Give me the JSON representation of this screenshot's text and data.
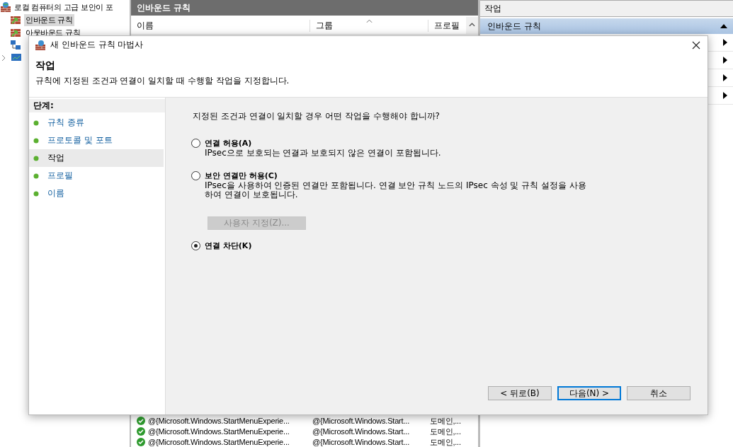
{
  "console": {
    "tree": [
      {
        "label": "로컬 컴퓨터의 고급 보안이 포",
        "selected": false,
        "children": [
          {
            "label": "인바운드 규칙",
            "selected": true
          },
          {
            "label": "아웃바운드 규칙",
            "selected": false
          }
        ]
      }
    ],
    "center": {
      "title": "인바운드 규칙",
      "columns": [
        "이름",
        "그룹",
        "프로필"
      ],
      "rows": [
        [
          "@{Microsoft.Windows.StartMenuExperie...",
          "@{Microsoft.Windows.Start...",
          "도메인,..."
        ],
        [
          "@{Microsoft.Windows.StartMenuExperie...",
          "@{Microsoft.Windows.Start...",
          "도메인,..."
        ],
        [
          "@{Microsoft.Windows.StartMenuExperie...",
          "@{Microsoft.Windows.Start...",
          "도메인,..."
        ]
      ]
    },
    "actions": {
      "title": "작업",
      "section": "인바운드 규칙"
    }
  },
  "dialog": {
    "title": "새 인바운드 규칙 마법사",
    "heading": "작업",
    "description": "규칙에 지정된 조건과 연결이 일치할 때 수행할 작업을 지정합니다.",
    "steps_title": "단계:",
    "steps": [
      {
        "label": "규칙 종류",
        "selected": false
      },
      {
        "label": "프로토콜 및 포트",
        "selected": false
      },
      {
        "label": "작업",
        "selected": true
      },
      {
        "label": "프로필",
        "selected": false
      },
      {
        "label": "이름",
        "selected": false
      }
    ],
    "question": "지정된 조건과 연결이 일치할 경우 어떤 작업을 수행해야 합니까?",
    "options": [
      {
        "label": "연결 허용(A)",
        "description": "IPsec으로 보호되는 연결과 보호되지 않은 연결이 포함됩니다.",
        "selected": false
      },
      {
        "label": "보안 연결만 허용(C)",
        "description": "IPsec을 사용하여 인증된 연결만 포함됩니다. 연결 보안 규칙 노드의 IPsec 속성 및 규칙 설정을 사용하여 연결이 보호됩니다.",
        "selected": false,
        "button": {
          "label": "사용자 지정(Z)...",
          "disabled": true
        }
      },
      {
        "label": "연결 차단(K)",
        "selected": true
      }
    ],
    "buttons": [
      {
        "label": "< 뒤로(B)",
        "default": false
      },
      {
        "label": "다음(N) >",
        "default": true
      },
      {
        "label": "취소",
        "default": false
      }
    ]
  }
}
